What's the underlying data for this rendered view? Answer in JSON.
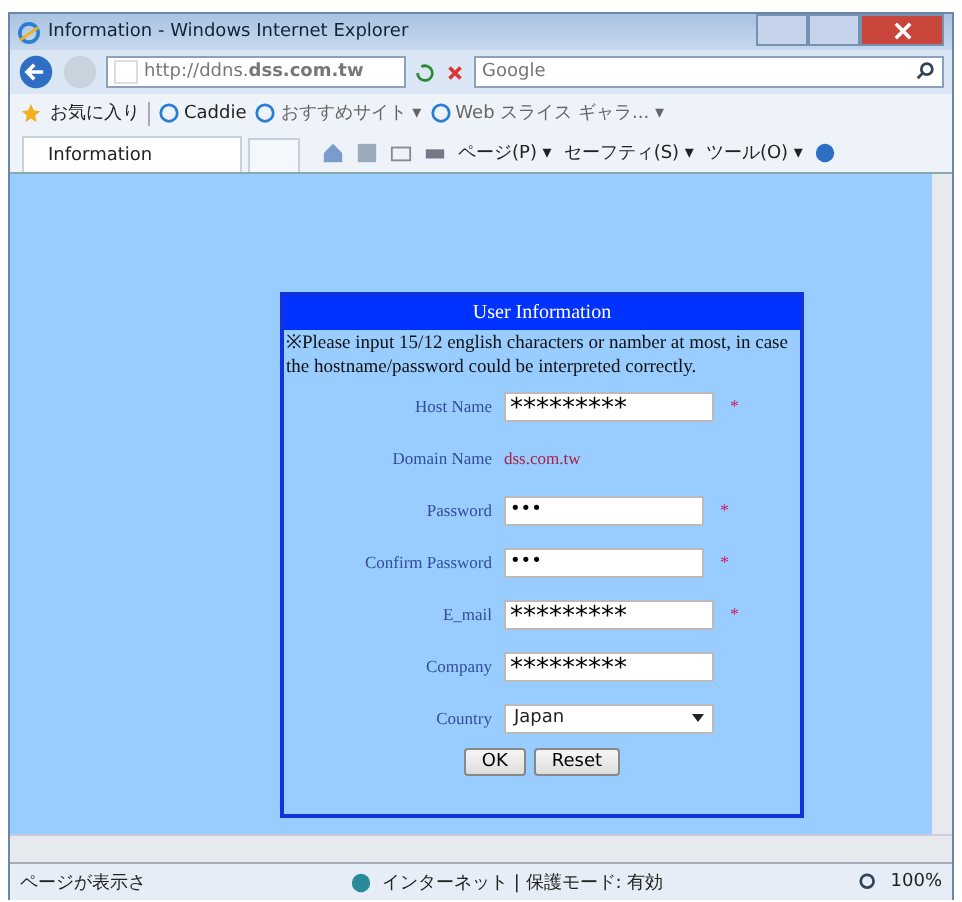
{
  "window": {
    "title": "Information - Windows Internet Explorer"
  },
  "address_bar": {
    "url": "http://ddns.**dss.com.tw**",
    "search_placeholder": "Google"
  },
  "favorites_bar": {
    "favorites": "お気に入り",
    "links": [
      "Caddie",
      "おすすめサイト ▾",
      "Web スライス ギャラ... ▾"
    ]
  },
  "tab_bar": {
    "tabs": [
      {
        "label": "Information",
        "selected": true
      }
    ],
    "commands": [
      "ページ(P) ▾",
      "セーフティ(S) ▾",
      "ツール(O) ▾"
    ]
  },
  "form": {
    "title": "User Information",
    "note": "※Please input 15/12 english characters or namber at most, in case the hostname/password could be interpreted correctly.",
    "rows": [
      {
        "kind": "input",
        "label": "Host Name",
        "value": "*********",
        "required": true
      },
      {
        "kind": "text",
        "label": "Domain Name",
        "value": "dss.com.tw"
      },
      {
        "kind": "input",
        "label": "Password",
        "value": "•••",
        "required": true
      },
      {
        "kind": "input",
        "label": "Confirm Password",
        "value": "•••",
        "required": true
      },
      {
        "kind": "input",
        "label": "E_mail",
        "value": "*********",
        "required": true
      },
      {
        "kind": "input",
        "label": "Company",
        "value": "*********",
        "required": false
      },
      {
        "kind": "select",
        "label": "Country",
        "value": "Japan"
      }
    ],
    "required_mark": "*",
    "buttons": [
      "OK",
      "Reset"
    ]
  },
  "status_bar": {
    "message": "ページが表示さ",
    "zone": "インターネット | 保護モード: 有効",
    "zoom": "100%"
  }
}
